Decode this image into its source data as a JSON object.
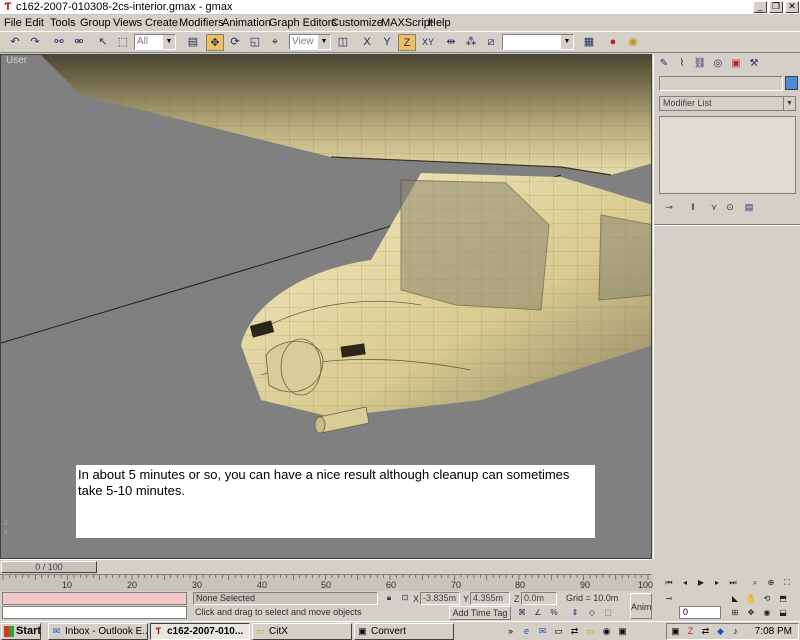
{
  "window": {
    "title": "c162-2007-010308-2cs-interior.gmax - gmax",
    "app_icon": "gmax-icon",
    "controls": {
      "minimize": "_",
      "restore": "❐",
      "close": "✕"
    }
  },
  "menu": [
    "File",
    "Edit",
    "Tools",
    "Group",
    "Views",
    "Create",
    "Modifiers",
    "Animation",
    "Graph Editors",
    "Customize",
    "MAXScript",
    "Help"
  ],
  "toolbar": {
    "selection_filter": "All",
    "reference_coord": "View",
    "named_selection": "",
    "constraint_labels": [
      "X",
      "Y",
      "Z",
      "XY"
    ]
  },
  "viewport": {
    "label": "User",
    "caption": "In about 5 minutes or so, you can have a nice result although cleanup can sometimes take 5-10 minutes.",
    "axis_labels": [
      "z",
      "x"
    ]
  },
  "command_panel": {
    "object_name": "",
    "object_color": "#4a8ad8",
    "modifier_list": "Modifier List"
  },
  "timeline": {
    "frame_indicator": "0 / 100",
    "ruler_labels": [
      "10",
      "20",
      "30",
      "40",
      "50",
      "60",
      "70",
      "80",
      "90",
      "100"
    ]
  },
  "status": {
    "selection": "None Selected",
    "prompt": "Click and drag to select and move objects",
    "x_label": "X",
    "x_value": "-3.835m",
    "y_label": "Y",
    "y_value": "4.355m",
    "z_label": "Z",
    "z_value": "0.0m",
    "grid": "Grid = 10.0m",
    "add_time_tag": "Add Time Tag",
    "anim_button": "Anim",
    "current_frame": "0"
  },
  "taskbar": {
    "start": "Start",
    "tasks": [
      {
        "label": "Inbox - Outlook E...",
        "icon": "outlook-icon",
        "pressed": false
      },
      {
        "label": "c162-2007-010...",
        "icon": "gmax-icon",
        "pressed": true
      },
      {
        "label": "CitX",
        "icon": "folder-icon",
        "pressed": false
      },
      {
        "label": "Convert",
        "icon": "app-icon",
        "pressed": false
      }
    ],
    "tray_expand": "»",
    "clock": "7:08 PM"
  }
}
